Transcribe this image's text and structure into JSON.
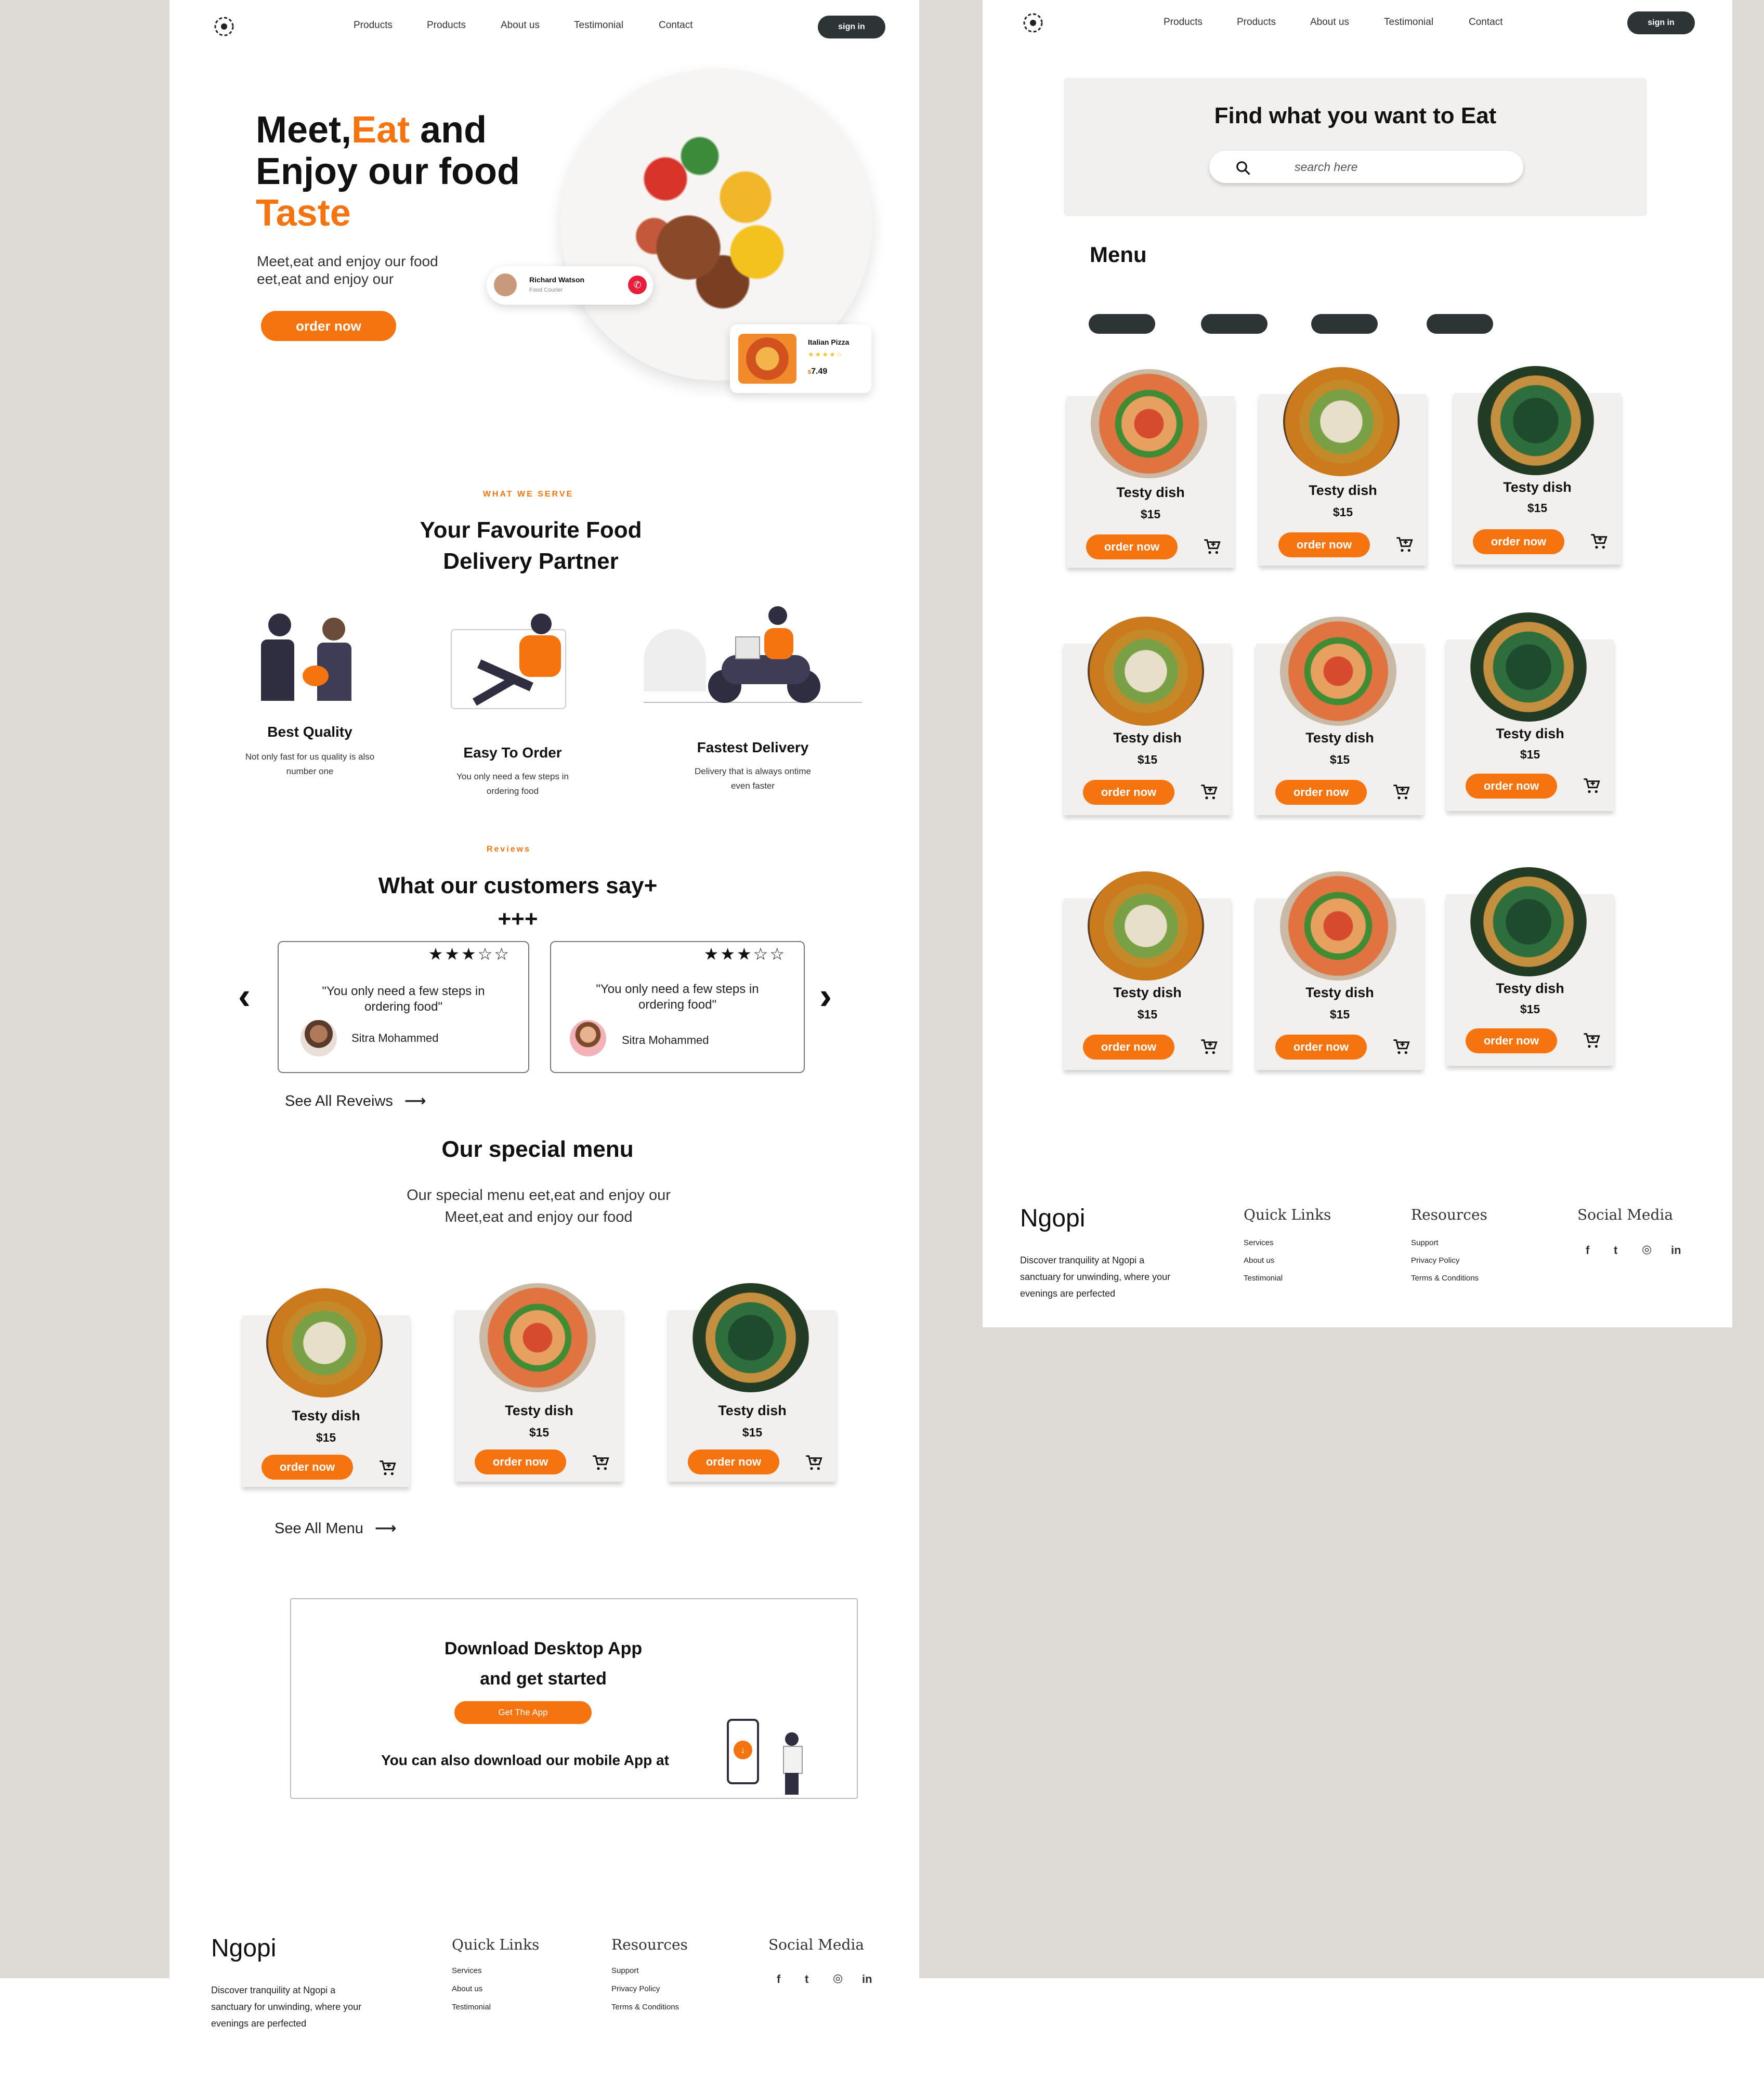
{
  "nav": {
    "links": [
      "Products",
      "Products",
      "About us",
      "Testimonial",
      "Contact"
    ],
    "sign_in": "sign in"
  },
  "hero": {
    "title_meet": "Meet,",
    "title_eat": "Eat",
    "title_and": " and",
    "title_line2": "Enjoy our food",
    "title_taste": "Taste",
    "subtitle_line1": "Meet,eat  and enjoy our food",
    "subtitle_line2": "eet,eat  and enjoy our",
    "order_now": "order now",
    "courier_name": "Richard Watson",
    "courier_role": "Food Courier",
    "pizza_name": "Italian Pizza",
    "pizza_stars": "★★★★☆",
    "pizza_currency": "$",
    "pizza_price": "7.49"
  },
  "serve": {
    "eyebrow": "WHAT WE SERVE",
    "heading_line1": "Your Favourite Food",
    "heading_line2": "Delivery Partner",
    "features": [
      {
        "title": "Best Quality",
        "desc_line1": "Not only fast for us quality is also",
        "desc_line2": "number one"
      },
      {
        "title": "Easy To Order",
        "desc_line1": "You only need a few steps in",
        "desc_line2": "ordering food"
      },
      {
        "title": "Fastest Delivery",
        "desc_line1": "Delivery that is always ontime",
        "desc_line2": "even faster"
      }
    ]
  },
  "reviews": {
    "eyebrow": "Reviews",
    "heading": "What our customers say+",
    "heading_line2": "+++",
    "items": [
      {
        "stars": "★★★☆☆",
        "quote_line1": "\"You only need a few steps in",
        "quote_line2": "ordering food\"",
        "name": "Sitra Mohammed"
      },
      {
        "stars": "★★★☆☆",
        "quote_line1": "\"You only need a few steps in",
        "quote_line2": "ordering food\"",
        "name": "Sitra Mohammed"
      }
    ],
    "prev_icon": "‹",
    "next_icon": "›",
    "see_all": "See All Reveiws",
    "arrow": "⟶"
  },
  "special": {
    "heading": "Our special menu",
    "desc_line1": "Our special menu eet,eat  and enjoy our",
    "desc_line2": "Meet,eat  and enjoy our food",
    "see_all": "See All Menu",
    "arrow": "⟶"
  },
  "dish": {
    "name": "Testy dish",
    "price": "$15",
    "order": "order now"
  },
  "download": {
    "heading_line1": "Download  Desktop App",
    "heading_line2": "and get started",
    "button": "Get The App",
    "mobile_text": "You can also download our mobile App at"
  },
  "search_panel": {
    "heading": "Find what you want to Eat",
    "placeholder": "search here"
  },
  "menu": {
    "heading": "Menu"
  },
  "footer": {
    "brand": "Ngopi",
    "tagline_line1": "Discover tranquility at Ngopi a",
    "tagline_line2": "sanctuary for unwinding, where your",
    "tagline_line3": "evenings are perfected",
    "quick_links_heading": "Quick Links",
    "quick_links": [
      "Services",
      "About us",
      "Testimonial"
    ],
    "resources_heading": "Resources",
    "resources": [
      "Support",
      "Privacy Policy",
      "Terms & Conditions"
    ],
    "social_heading": "Social Media",
    "social_icons": [
      "f",
      "t",
      "◎",
      "in"
    ]
  },
  "colors": {
    "accent": "#f5740f",
    "dark": "#2d3436",
    "backdrop": "#dedad5",
    "card": "#f1f0ee"
  }
}
